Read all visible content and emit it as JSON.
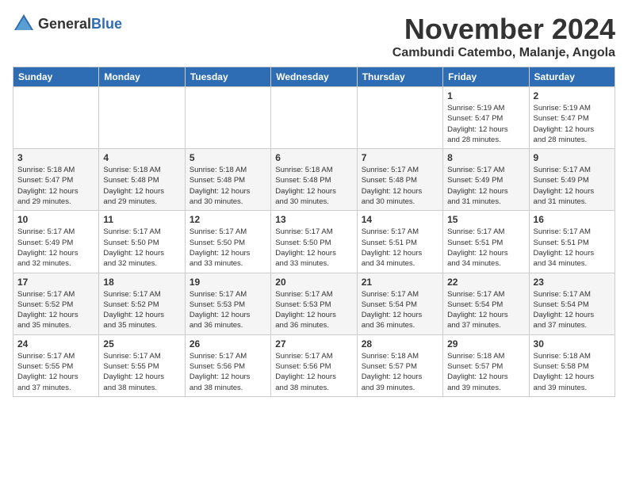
{
  "header": {
    "logo": {
      "general": "General",
      "blue": "Blue"
    },
    "month": "November 2024",
    "location": "Cambundi Catembo, Malanje, Angola"
  },
  "weekdays": [
    "Sunday",
    "Monday",
    "Tuesday",
    "Wednesday",
    "Thursday",
    "Friday",
    "Saturday"
  ],
  "weeks": [
    [
      {
        "day": "",
        "info": ""
      },
      {
        "day": "",
        "info": ""
      },
      {
        "day": "",
        "info": ""
      },
      {
        "day": "",
        "info": ""
      },
      {
        "day": "",
        "info": ""
      },
      {
        "day": "1",
        "info": "Sunrise: 5:19 AM\nSunset: 5:47 PM\nDaylight: 12 hours\nand 28 minutes."
      },
      {
        "day": "2",
        "info": "Sunrise: 5:19 AM\nSunset: 5:47 PM\nDaylight: 12 hours\nand 28 minutes."
      }
    ],
    [
      {
        "day": "3",
        "info": "Sunrise: 5:18 AM\nSunset: 5:47 PM\nDaylight: 12 hours\nand 29 minutes."
      },
      {
        "day": "4",
        "info": "Sunrise: 5:18 AM\nSunset: 5:48 PM\nDaylight: 12 hours\nand 29 minutes."
      },
      {
        "day": "5",
        "info": "Sunrise: 5:18 AM\nSunset: 5:48 PM\nDaylight: 12 hours\nand 30 minutes."
      },
      {
        "day": "6",
        "info": "Sunrise: 5:18 AM\nSunset: 5:48 PM\nDaylight: 12 hours\nand 30 minutes."
      },
      {
        "day": "7",
        "info": "Sunrise: 5:17 AM\nSunset: 5:48 PM\nDaylight: 12 hours\nand 30 minutes."
      },
      {
        "day": "8",
        "info": "Sunrise: 5:17 AM\nSunset: 5:49 PM\nDaylight: 12 hours\nand 31 minutes."
      },
      {
        "day": "9",
        "info": "Sunrise: 5:17 AM\nSunset: 5:49 PM\nDaylight: 12 hours\nand 31 minutes."
      }
    ],
    [
      {
        "day": "10",
        "info": "Sunrise: 5:17 AM\nSunset: 5:49 PM\nDaylight: 12 hours\nand 32 minutes."
      },
      {
        "day": "11",
        "info": "Sunrise: 5:17 AM\nSunset: 5:50 PM\nDaylight: 12 hours\nand 32 minutes."
      },
      {
        "day": "12",
        "info": "Sunrise: 5:17 AM\nSunset: 5:50 PM\nDaylight: 12 hours\nand 33 minutes."
      },
      {
        "day": "13",
        "info": "Sunrise: 5:17 AM\nSunset: 5:50 PM\nDaylight: 12 hours\nand 33 minutes."
      },
      {
        "day": "14",
        "info": "Sunrise: 5:17 AM\nSunset: 5:51 PM\nDaylight: 12 hours\nand 34 minutes."
      },
      {
        "day": "15",
        "info": "Sunrise: 5:17 AM\nSunset: 5:51 PM\nDaylight: 12 hours\nand 34 minutes."
      },
      {
        "day": "16",
        "info": "Sunrise: 5:17 AM\nSunset: 5:51 PM\nDaylight: 12 hours\nand 34 minutes."
      }
    ],
    [
      {
        "day": "17",
        "info": "Sunrise: 5:17 AM\nSunset: 5:52 PM\nDaylight: 12 hours\nand 35 minutes."
      },
      {
        "day": "18",
        "info": "Sunrise: 5:17 AM\nSunset: 5:52 PM\nDaylight: 12 hours\nand 35 minutes."
      },
      {
        "day": "19",
        "info": "Sunrise: 5:17 AM\nSunset: 5:53 PM\nDaylight: 12 hours\nand 36 minutes."
      },
      {
        "day": "20",
        "info": "Sunrise: 5:17 AM\nSunset: 5:53 PM\nDaylight: 12 hours\nand 36 minutes."
      },
      {
        "day": "21",
        "info": "Sunrise: 5:17 AM\nSunset: 5:54 PM\nDaylight: 12 hours\nand 36 minutes."
      },
      {
        "day": "22",
        "info": "Sunrise: 5:17 AM\nSunset: 5:54 PM\nDaylight: 12 hours\nand 37 minutes."
      },
      {
        "day": "23",
        "info": "Sunrise: 5:17 AM\nSunset: 5:54 PM\nDaylight: 12 hours\nand 37 minutes."
      }
    ],
    [
      {
        "day": "24",
        "info": "Sunrise: 5:17 AM\nSunset: 5:55 PM\nDaylight: 12 hours\nand 37 minutes."
      },
      {
        "day": "25",
        "info": "Sunrise: 5:17 AM\nSunset: 5:55 PM\nDaylight: 12 hours\nand 38 minutes."
      },
      {
        "day": "26",
        "info": "Sunrise: 5:17 AM\nSunset: 5:56 PM\nDaylight: 12 hours\nand 38 minutes."
      },
      {
        "day": "27",
        "info": "Sunrise: 5:17 AM\nSunset: 5:56 PM\nDaylight: 12 hours\nand 38 minutes."
      },
      {
        "day": "28",
        "info": "Sunrise: 5:18 AM\nSunset: 5:57 PM\nDaylight: 12 hours\nand 39 minutes."
      },
      {
        "day": "29",
        "info": "Sunrise: 5:18 AM\nSunset: 5:57 PM\nDaylight: 12 hours\nand 39 minutes."
      },
      {
        "day": "30",
        "info": "Sunrise: 5:18 AM\nSunset: 5:58 PM\nDaylight: 12 hours\nand 39 minutes."
      }
    ]
  ]
}
